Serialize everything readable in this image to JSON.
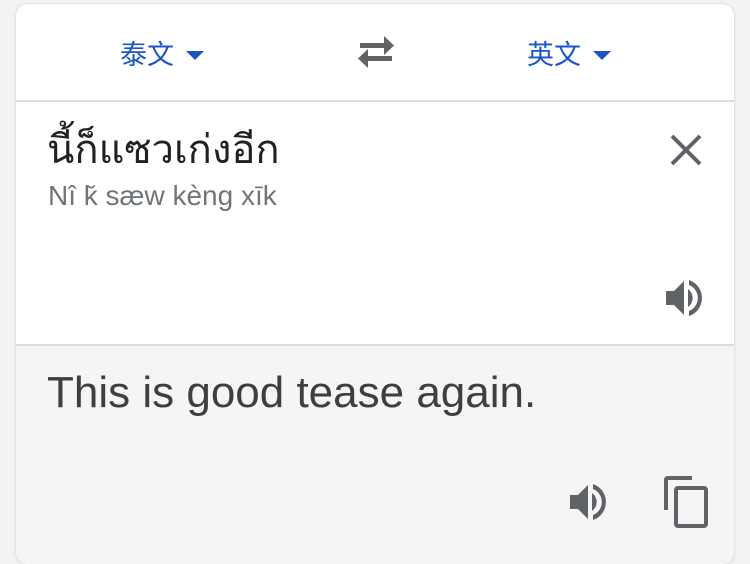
{
  "languages": {
    "source": "泰文",
    "target": "英文"
  },
  "source": {
    "text": "นี้ก็แซวเก่งอีก",
    "transliteration": "Nî k̆ sæw kèng xīk"
  },
  "translation": {
    "text": "This is good tease again."
  },
  "icons": {
    "swap": "swap-arrows-icon",
    "clear": "close-icon",
    "speaker": "speaker-icon",
    "copy": "copy-icon"
  },
  "colors": {
    "accent": "#1a55c4",
    "icon": "#5f6368",
    "divider": "#dadce0",
    "translation_bg": "#f5f5f5"
  }
}
